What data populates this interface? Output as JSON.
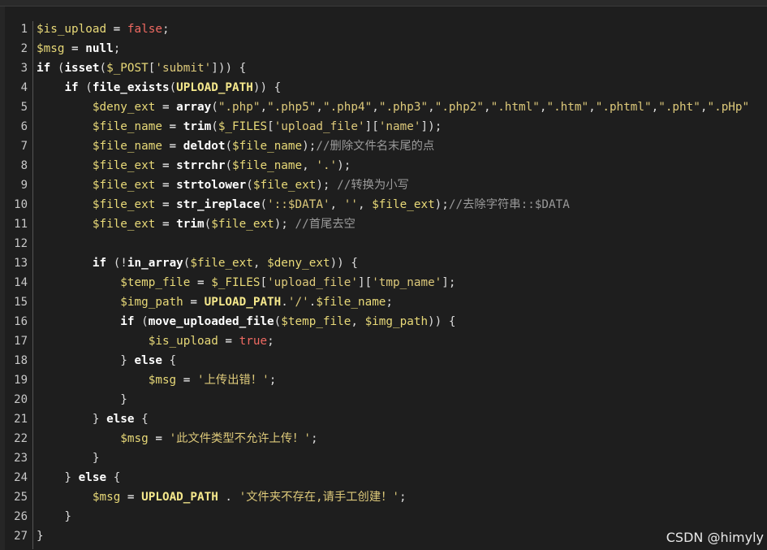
{
  "watermark": "CSDN @himyly",
  "line_numbers": [
    "1",
    "2",
    "3",
    "4",
    "5",
    "6",
    "7",
    "8",
    "9",
    "10",
    "11",
    "12",
    "13",
    "14",
    "15",
    "16",
    "17",
    "18",
    "19",
    "20",
    "21",
    "22",
    "23",
    "24",
    "25",
    "26",
    "27"
  ],
  "code_lines": [
    [
      [
        "var",
        "$is_upload"
      ],
      [
        "op",
        " = "
      ],
      [
        "bool",
        "false"
      ],
      [
        "p",
        ";"
      ]
    ],
    [
      [
        "var",
        "$msg"
      ],
      [
        "op",
        " = "
      ],
      [
        "null",
        "null"
      ],
      [
        "p",
        ";"
      ]
    ],
    [
      [
        "kw",
        "if"
      ],
      [
        "p",
        " ("
      ],
      [
        "fn",
        "isset"
      ],
      [
        "p",
        "("
      ],
      [
        "var",
        "$_POST"
      ],
      [
        "p",
        "["
      ],
      [
        "str",
        "'submit'"
      ],
      [
        "p",
        "])) {"
      ]
    ],
    [
      [
        "p",
        "    "
      ],
      [
        "kw",
        "if"
      ],
      [
        "p",
        " ("
      ],
      [
        "fn",
        "file_exists"
      ],
      [
        "p",
        "("
      ],
      [
        "const",
        "UPLOAD_PATH"
      ],
      [
        "p",
        ")) {"
      ]
    ],
    [
      [
        "p",
        "        "
      ],
      [
        "var",
        "$deny_ext"
      ],
      [
        "op",
        " = "
      ],
      [
        "fn",
        "array"
      ],
      [
        "p",
        "("
      ],
      [
        "str",
        "\".php\""
      ],
      [
        "p",
        ","
      ],
      [
        "str",
        "\".php5\""
      ],
      [
        "p",
        ","
      ],
      [
        "str",
        "\".php4\""
      ],
      [
        "p",
        ","
      ],
      [
        "str",
        "\".php3\""
      ],
      [
        "p",
        ","
      ],
      [
        "str",
        "\".php2\""
      ],
      [
        "p",
        ","
      ],
      [
        "str",
        "\".html\""
      ],
      [
        "p",
        ","
      ],
      [
        "str",
        "\".htm\""
      ],
      [
        "p",
        ","
      ],
      [
        "str",
        "\".phtml\""
      ],
      [
        "p",
        ","
      ],
      [
        "str",
        "\".pht\""
      ],
      [
        "p",
        ","
      ],
      [
        "str",
        "\".pHp\""
      ]
    ],
    [
      [
        "p",
        "        "
      ],
      [
        "var",
        "$file_name"
      ],
      [
        "op",
        " = "
      ],
      [
        "fn",
        "trim"
      ],
      [
        "p",
        "("
      ],
      [
        "var",
        "$_FILES"
      ],
      [
        "p",
        "["
      ],
      [
        "str",
        "'upload_file'"
      ],
      [
        "p",
        "]["
      ],
      [
        "str",
        "'name'"
      ],
      [
        "p",
        "]);"
      ]
    ],
    [
      [
        "p",
        "        "
      ],
      [
        "var",
        "$file_name"
      ],
      [
        "op",
        " = "
      ],
      [
        "fn",
        "deldot"
      ],
      [
        "p",
        "("
      ],
      [
        "var",
        "$file_name"
      ],
      [
        "p",
        ");"
      ],
      [
        "cmt",
        "//删除文件名末尾的点"
      ]
    ],
    [
      [
        "p",
        "        "
      ],
      [
        "var",
        "$file_ext"
      ],
      [
        "op",
        " = "
      ],
      [
        "fn",
        "strrchr"
      ],
      [
        "p",
        "("
      ],
      [
        "var",
        "$file_name"
      ],
      [
        "p",
        ", "
      ],
      [
        "str",
        "'.'"
      ],
      [
        "p",
        ");"
      ]
    ],
    [
      [
        "p",
        "        "
      ],
      [
        "var",
        "$file_ext"
      ],
      [
        "op",
        " = "
      ],
      [
        "fn",
        "strtolower"
      ],
      [
        "p",
        "("
      ],
      [
        "var",
        "$file_ext"
      ],
      [
        "p",
        "); "
      ],
      [
        "cmt",
        "//转换为小写"
      ]
    ],
    [
      [
        "p",
        "        "
      ],
      [
        "var",
        "$file_ext"
      ],
      [
        "op",
        " = "
      ],
      [
        "fn",
        "str_ireplace"
      ],
      [
        "p",
        "("
      ],
      [
        "str",
        "'::$DATA'"
      ],
      [
        "p",
        ", "
      ],
      [
        "str",
        "''"
      ],
      [
        "p",
        ", "
      ],
      [
        "var",
        "$file_ext"
      ],
      [
        "p",
        ");"
      ],
      [
        "cmt",
        "//去除字符串::$DATA"
      ]
    ],
    [
      [
        "p",
        "        "
      ],
      [
        "var",
        "$file_ext"
      ],
      [
        "op",
        " = "
      ],
      [
        "fn",
        "trim"
      ],
      [
        "p",
        "("
      ],
      [
        "var",
        "$file_ext"
      ],
      [
        "p",
        "); "
      ],
      [
        "cmt",
        "//首尾去空"
      ]
    ],
    [
      [
        "p",
        ""
      ]
    ],
    [
      [
        "p",
        "        "
      ],
      [
        "kw",
        "if"
      ],
      [
        "p",
        " (!"
      ],
      [
        "fn",
        "in_array"
      ],
      [
        "p",
        "("
      ],
      [
        "var",
        "$file_ext"
      ],
      [
        "p",
        ", "
      ],
      [
        "var",
        "$deny_ext"
      ],
      [
        "p",
        ")) {"
      ]
    ],
    [
      [
        "p",
        "            "
      ],
      [
        "var",
        "$temp_file"
      ],
      [
        "op",
        " = "
      ],
      [
        "var",
        "$_FILES"
      ],
      [
        "p",
        "["
      ],
      [
        "str",
        "'upload_file'"
      ],
      [
        "p",
        "]["
      ],
      [
        "str",
        "'tmp_name'"
      ],
      [
        "p",
        "];"
      ]
    ],
    [
      [
        "p",
        "            "
      ],
      [
        "var",
        "$img_path"
      ],
      [
        "op",
        " = "
      ],
      [
        "const",
        "UPLOAD_PATH"
      ],
      [
        "p",
        "."
      ],
      [
        "str",
        "'/'"
      ],
      [
        "p",
        "."
      ],
      [
        "var",
        "$file_name"
      ],
      [
        "p",
        ";"
      ]
    ],
    [
      [
        "p",
        "            "
      ],
      [
        "kw",
        "if"
      ],
      [
        "p",
        " ("
      ],
      [
        "fn",
        "move_uploaded_file"
      ],
      [
        "p",
        "("
      ],
      [
        "var",
        "$temp_file"
      ],
      [
        "p",
        ", "
      ],
      [
        "var",
        "$img_path"
      ],
      [
        "p",
        ")) {"
      ]
    ],
    [
      [
        "p",
        "                "
      ],
      [
        "var",
        "$is_upload"
      ],
      [
        "op",
        " = "
      ],
      [
        "bool",
        "true"
      ],
      [
        "p",
        ";"
      ]
    ],
    [
      [
        "p",
        "            } "
      ],
      [
        "kw",
        "else"
      ],
      [
        "p",
        " {"
      ]
    ],
    [
      [
        "p",
        "                "
      ],
      [
        "var",
        "$msg"
      ],
      [
        "op",
        " = "
      ],
      [
        "str",
        "'上传出错！'"
      ],
      [
        "p",
        ";"
      ]
    ],
    [
      [
        "p",
        "            }"
      ]
    ],
    [
      [
        "p",
        "        } "
      ],
      [
        "kw",
        "else"
      ],
      [
        "p",
        " {"
      ]
    ],
    [
      [
        "p",
        "            "
      ],
      [
        "var",
        "$msg"
      ],
      [
        "op",
        " = "
      ],
      [
        "str",
        "'此文件类型不允许上传！'"
      ],
      [
        "p",
        ";"
      ]
    ],
    [
      [
        "p",
        "        }"
      ]
    ],
    [
      [
        "p",
        "    } "
      ],
      [
        "kw",
        "else"
      ],
      [
        "p",
        " {"
      ]
    ],
    [
      [
        "p",
        "        "
      ],
      [
        "var",
        "$msg"
      ],
      [
        "op",
        " = "
      ],
      [
        "const",
        "UPLOAD_PATH"
      ],
      [
        "p",
        " . "
      ],
      [
        "str",
        "'文件夹不存在,请手工创建！'"
      ],
      [
        "p",
        ";"
      ]
    ],
    [
      [
        "p",
        "    }"
      ]
    ],
    [
      [
        "p",
        "}"
      ]
    ]
  ]
}
